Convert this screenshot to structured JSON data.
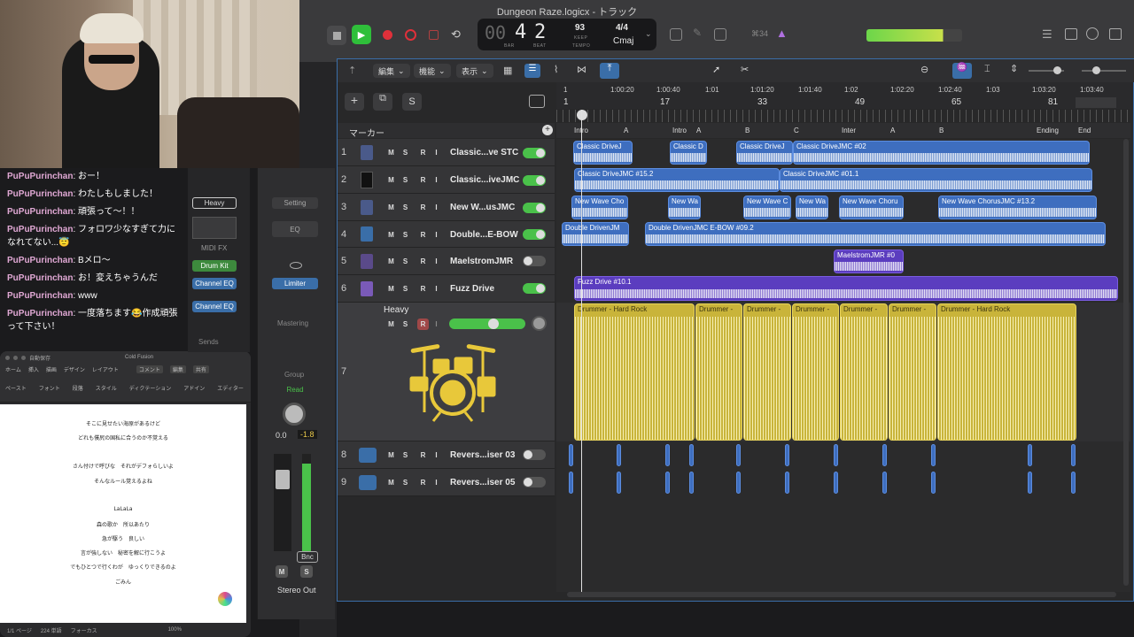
{
  "window": {
    "title": "Dungeon Raze.logicx - トラック"
  },
  "transport": {
    "bar": "4",
    "beat": "2",
    "bar_prefix": "00",
    "bar_label": "BAR",
    "beat_label": "BEAT",
    "tempo": "93",
    "tempo_label": "KEEP",
    "tempo_sub": "TEMPO",
    "signature": "4/4",
    "key": "Cmaj",
    "midi_count": "⌘34"
  },
  "chat": [
    {
      "user": "PuPuPurinchan",
      "text": "おー！"
    },
    {
      "user": "PuPuPurinchan",
      "text": "わたしもしました！"
    },
    {
      "user": "PuPuPurinchan",
      "text": "頑張って〜！！"
    },
    {
      "user": "PuPuPurinchan",
      "text": "フォロワ少なすぎて力になれてない...😇"
    },
    {
      "user": "PuPuPurinchan",
      "text": "Bメロ〜"
    },
    {
      "user": "PuPuPurinchan",
      "text": "お！変えちゃうんだ"
    },
    {
      "user": "PuPuPurinchan",
      "text": "www"
    },
    {
      "user": "PuPuPurinchan",
      "text": "一度落ちます😂作成頑張って下さい！"
    }
  ],
  "word": {
    "app_bar": "自動保存",
    "doc_title": "Cold Fusion",
    "tabs": [
      "ホーム",
      "挿入",
      "描画",
      "デザイン",
      "レイアウト"
    ],
    "comment_btn": "コメント",
    "edit_btn": "編集",
    "share_btn": "共有",
    "ribbon": [
      "ペースト",
      "フォント",
      "段落",
      "スタイル",
      "ディクテーション",
      "アドイン",
      "エディター"
    ],
    "lyrics": [
      "そこに見せたい海原があるけど",
      "どれも僕尻の国私に合うのか不覚える",
      "さん付けで呼びな　それがデフォらしいよ",
      "そんなルール覚えるよね",
      "LaLaLa",
      "森の歌か　所以あたり",
      "急が駆う　良しい",
      "言が強しない　秘密を解に行こうよ",
      "でもひとつで行くわが　ゆっくりできるのよ",
      "ごみん"
    ],
    "status": [
      "1/1 ページ",
      "224 単語",
      "フォーカス",
      "100%"
    ]
  },
  "inspector": {
    "preset": "Heavy",
    "midi_fx": "MIDI FX",
    "drum_kit": "Drum Kit",
    "channel_eq_1": "Channel EQ",
    "channel_eq_2": "Channel EQ",
    "sends": "Sends",
    "setting": "Setting",
    "eq": "EQ",
    "limiter": "Limiter",
    "mastering": "Mastering",
    "group": "Group",
    "read": "Read",
    "pan_val": "0.0",
    "gain_val": "-1.8",
    "bnc": "Bnc",
    "m": "M",
    "s": "S",
    "out": "Stereo Out"
  },
  "tracks_toolbar": {
    "edit": "編集",
    "function": "機能",
    "view": "表示",
    "s_btn": "S",
    "marker_lane": "マーカー"
  },
  "tracks": [
    {
      "num": "1",
      "name": "Classic...ve STC"
    },
    {
      "num": "2",
      "name": "Classic...iveJMC"
    },
    {
      "num": "3",
      "name": "New W...usJMC"
    },
    {
      "num": "4",
      "name": "Double...E-BOW"
    },
    {
      "num": "5",
      "name": "MaelstromJMR"
    },
    {
      "num": "6",
      "name": "Fuzz Drive"
    },
    {
      "num": "7",
      "name": "Heavy"
    },
    {
      "num": "8",
      "name": "Revers...iser 03"
    },
    {
      "num": "9",
      "name": "Revers...iser 05"
    }
  ],
  "msri": [
    "M",
    "S",
    "R",
    "I"
  ],
  "ruler": {
    "times": [
      "1",
      "1:00:20",
      "1:00:40",
      "1:01",
      "1:01:20",
      "1:01:40",
      "1:02",
      "1:02:20",
      "1:02:40",
      "1:03",
      "1:03:20",
      "1:03:40"
    ],
    "bars": [
      "1",
      "17",
      "33",
      "49",
      "65",
      "81"
    ]
  },
  "markers": [
    "Intro",
    "A",
    "Intro",
    "A",
    "B",
    "C",
    "Inter",
    "A",
    "B",
    "Ending",
    "End"
  ],
  "regions": {
    "t1": [
      "Classic DriveJ",
      "Classic D",
      "Classic DriveJ",
      "Classic DriveJMC #02"
    ],
    "t2": [
      "Classic DriveJMC #15.2",
      "Classic DriveJMC #01.1"
    ],
    "t3": [
      "New Wave Cho",
      "New Wa",
      "New Wave C",
      "New Wa",
      "New Wave Choru",
      "New Wave ChorusJMC #13.2"
    ],
    "t4": [
      "Double DrivenJM",
      "Double DrivenJMC E-BOW #09.2"
    ],
    "t5": [
      "MaelstromJMR #0"
    ],
    "t6": [
      "Fuzz Drive #10.1"
    ],
    "t7": [
      "Drummer - Hard Rock",
      "Drummer -",
      "Drummer -",
      "Drummer -",
      "Drummer -",
      "Drummer -",
      "Drummer - Hard Rock"
    ]
  },
  "colors": {
    "accent": "#3e6ebf",
    "purple": "#5b3dbf",
    "drummer": "#c9b43a",
    "record": "#e0303a",
    "play": "#2fbf3a"
  }
}
